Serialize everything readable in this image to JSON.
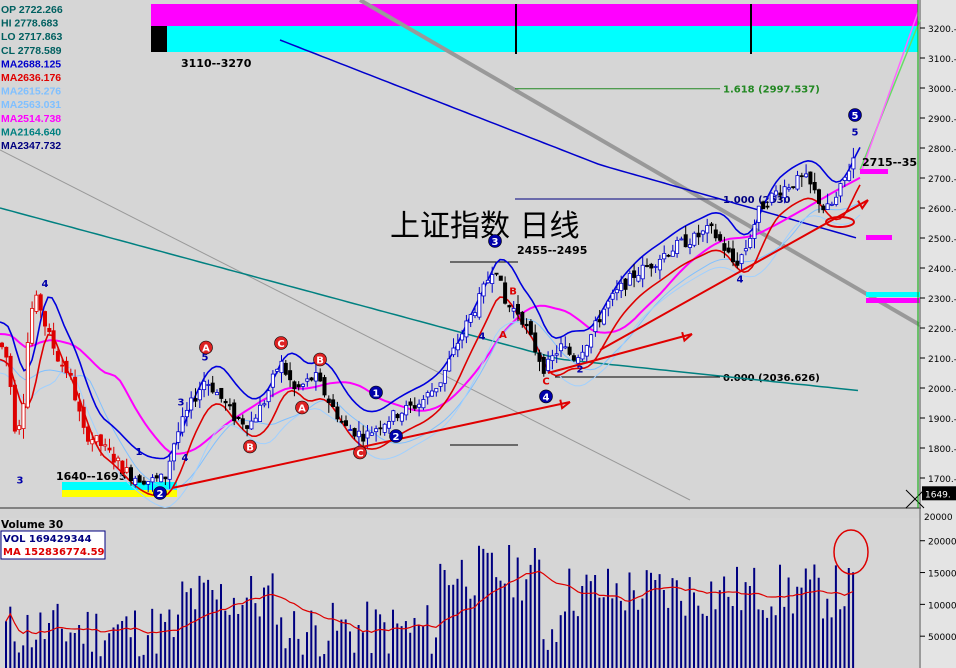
{
  "chart_data": [
    {
      "type": "candlestick",
      "title": "上证指数  日线",
      "ohlc_readout": [
        {
          "label": "OP 2722.266",
          "color": "#006060"
        },
        {
          "label": "HI 2778.683",
          "color": "#006060"
        },
        {
          "label": "LO 2717.863",
          "color": "#006060"
        },
        {
          "label": "CL 2778.589",
          "color": "#006060"
        }
      ],
      "ma_readout": [
        {
          "label": "MA2688.125",
          "color": "#0000cc"
        },
        {
          "label": "MA2636.176",
          "color": "#e00000"
        },
        {
          "label": "MA2615.276",
          "color": "#80c0ff"
        },
        {
          "label": "MA2563.031",
          "color": "#80c0ff"
        },
        {
          "label": "MA2514.738",
          "color": "#ff00ff"
        },
        {
          "label": "MA2164.640",
          "color": "#008080"
        },
        {
          "label": "MA2347.732",
          "color": "#000080"
        }
      ],
      "ylim": [
        1640,
        3280
      ],
      "yticks": [
        {
          "value": 3200,
          "label": "3200.-"
        },
        {
          "value": 3100,
          "label": "3100.-"
        },
        {
          "value": 3000,
          "label": "3000.-"
        },
        {
          "value": 2900,
          "label": "2900.-"
        },
        {
          "value": 2800,
          "label": "2800.-"
        },
        {
          "value": 2700,
          "label": "2700.-"
        },
        {
          "value": 2600,
          "label": "2600.-"
        },
        {
          "value": 2500,
          "label": "2500.-"
        },
        {
          "value": 2400,
          "label": "2400.-"
        },
        {
          "value": 2300,
          "label": "2300.-"
        },
        {
          "value": 2200,
          "label": "2200.-"
        },
        {
          "value": 2100,
          "label": "2100.-"
        },
        {
          "value": 2000,
          "label": "2000.-"
        },
        {
          "value": 1900,
          "label": "1900.-"
        },
        {
          "value": 1800,
          "label": "1800.-"
        },
        {
          "value": 1700,
          "label": "1700.-"
        }
      ],
      "last_label": "1649.",
      "annotations": {
        "zone_top": "3110--3270",
        "zone_bottom": "1640--1695",
        "zone_mid": "2455--2495",
        "zone_right": "2715--35",
        "fib_1618": "1.618 (2997.537)",
        "fib_1000": "1.000 (2630",
        "fib_0000": "0.000 (2036.626)"
      },
      "fib_levels": [
        2997.537,
        2630,
        2036.626
      ],
      "wave_labels": [
        {
          "t": "1",
          "c": "#0000aa",
          "circ": false,
          "x": 139,
          "v": 1790
        },
        {
          "t": "2",
          "c": "#ffffff",
          "circ": true,
          "bg": "#0000aa",
          "x": 160,
          "v": 1650
        },
        {
          "t": "3",
          "c": "#0000aa",
          "circ": false,
          "x": 181,
          "v": 1955
        },
        {
          "t": "4",
          "c": "#0000aa",
          "circ": false,
          "x": 185,
          "v": 1770
        },
        {
          "t": "5",
          "c": "#0000aa",
          "circ": false,
          "x": 205,
          "v": 2105
        },
        {
          "t": "A",
          "c": "#ffffff",
          "circ": true,
          "bg": "#dd2222",
          "x": 206,
          "v": 2135
        },
        {
          "t": "B",
          "c": "#ffffff",
          "circ": true,
          "bg": "#dd2222",
          "x": 250,
          "v": 1805
        },
        {
          "t": "C",
          "c": "#ffffff",
          "circ": true,
          "bg": "#dd2222",
          "x": 281,
          "v": 2150
        },
        {
          "t": "B",
          "c": "#ffffff",
          "circ": true,
          "bg": "#dd2222",
          "x": 320,
          "v": 2095
        },
        {
          "t": "A",
          "c": "#ffffff",
          "circ": true,
          "bg": "#dd2222",
          "x": 302,
          "v": 1935
        },
        {
          "t": "C",
          "c": "#ffffff",
          "circ": true,
          "bg": "#dd2222",
          "x": 360,
          "v": 1785
        },
        {
          "t": "1",
          "c": "#ffffff",
          "circ": true,
          "bg": "#0000aa",
          "x": 376,
          "v": 1985
        },
        {
          "t": "2",
          "c": "#ffffff",
          "circ": true,
          "bg": "#0000aa",
          "x": 396,
          "v": 1840
        },
        {
          "t": "3",
          "c": "#ffffff",
          "circ": true,
          "bg": "#0000aa",
          "x": 495,
          "v": 2490
        },
        {
          "t": "4",
          "c": "#ffffff",
          "circ": true,
          "bg": "#0000aa",
          "x": 546,
          "v": 1972
        },
        {
          "t": "5",
          "c": "#ffffff",
          "circ": true,
          "bg": "#0000aa",
          "x": 855,
          "v": 2910
        },
        {
          "t": "B",
          "c": "#dd0000",
          "circ": false,
          "x": 513,
          "v": 2325
        },
        {
          "t": "A",
          "c": "#dd0000",
          "circ": false,
          "x": 503,
          "v": 2180
        },
        {
          "t": "C",
          "c": "#dd0000",
          "circ": false,
          "x": 546,
          "v": 2025
        },
        {
          "t": "4",
          "c": "#0000aa",
          "circ": false,
          "x": 45,
          "v": 2350
        },
        {
          "t": "3",
          "c": "#0000aa",
          "circ": false,
          "x": 20,
          "v": 1695
        },
        {
          "t": "4",
          "c": "#0000aa",
          "circ": false,
          "x": 740,
          "v": 2365
        },
        {
          "t": "5",
          "c": "#0000aa",
          "circ": false,
          "x": 855,
          "v": 2855
        },
        {
          "t": "2",
          "c": "#0000aa",
          "circ": false,
          "x": 580,
          "v": 2065
        },
        {
          "t": "4",
          "c": "#0000aa",
          "circ": false,
          "x": 482,
          "v": 2175
        }
      ],
      "candles": {
        "start_value": 2100,
        "count": 140,
        "seed": 7
      }
    },
    {
      "type": "bar",
      "title": "Volume 30",
      "readouts": [
        {
          "label": "VOL 169429344",
          "color": "#000080"
        },
        {
          "label": "MA  152836774.59",
          "color": "#dd0000"
        }
      ],
      "ylim": [
        0,
        220000000
      ],
      "yticks": [
        {
          "value": 200000000,
          "label": "20000"
        },
        {
          "value": 150000000,
          "label": "15000"
        },
        {
          "value": 100000000,
          "label": "10000"
        },
        {
          "value": 50000000,
          "label": "50000"
        }
      ],
      "top_label": "20000"
    }
  ]
}
